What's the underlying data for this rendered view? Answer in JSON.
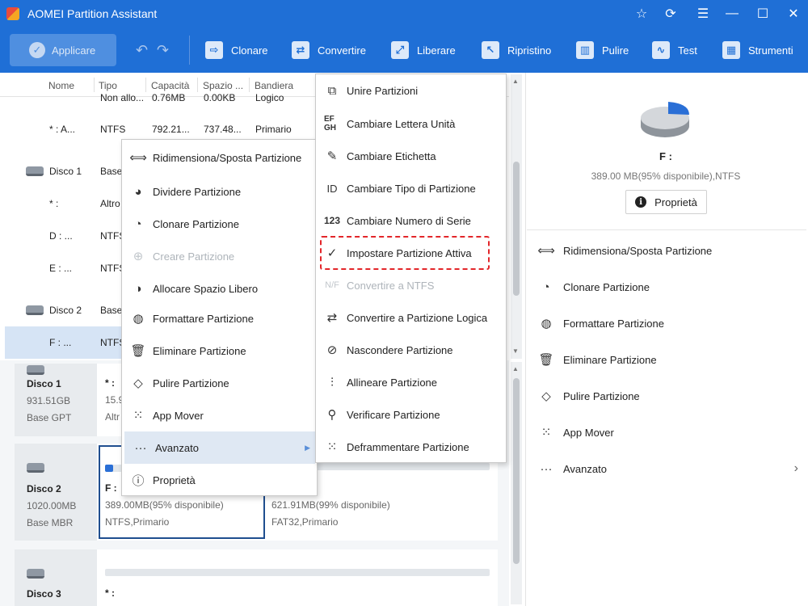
{
  "titlebar": {
    "title": "AOMEI Partition Assistant"
  },
  "window_controls": [
    "star-icon",
    "refresh-icon",
    "menu-icon",
    "minimize-icon",
    "maximize-icon",
    "close-icon"
  ],
  "toolbar": {
    "apply_label": "Applicare",
    "items": [
      {
        "label": "Clonare",
        "icon": "clone-icon"
      },
      {
        "label": "Convertire",
        "icon": "convert-icon"
      },
      {
        "label": "Liberare",
        "icon": "free-up-icon"
      },
      {
        "label": "Ripristino",
        "icon": "recovery-icon"
      },
      {
        "label": "Pulire",
        "icon": "wipe-icon"
      },
      {
        "label": "Test",
        "icon": "test-icon"
      },
      {
        "label": "Strumenti",
        "icon": "tools-icon"
      }
    ]
  },
  "columns": [
    "Nome",
    "Tipo",
    "Capacità",
    "Spazio ...",
    "Bandiera"
  ],
  "rows": [
    {
      "name": "",
      "type": "Non allo...",
      "cap": "0.76MB",
      "used": "0.00KB",
      "flag": "Logico"
    },
    {
      "name": "* : A...",
      "type": "NTFS",
      "cap": "792.21...",
      "used": "737.48...",
      "flag": "Primario"
    },
    {
      "name": "Disco 1",
      "type": "Base",
      "disk": true
    },
    {
      "name": "* :",
      "type": "Altro"
    },
    {
      "name": "D : ...",
      "type": "NTFS"
    },
    {
      "name": "E : ...",
      "type": "NTFS"
    },
    {
      "name": "Disco 2",
      "type": "Base",
      "disk": true
    },
    {
      "name": "F : ...",
      "type": "NTFS",
      "selected": true
    }
  ],
  "disks": [
    {
      "name": "Disco 1",
      "size": "931.51GB",
      "type": "Base GPT",
      "p1_name": "* :",
      "p1_size": "15.9",
      "p1_fs": "Altr"
    },
    {
      "name": "Disco 2",
      "size": "1020.00MB",
      "type": "Base MBR",
      "p1_name": "F :",
      "p1_size": "389.00MB(95% disponibile)",
      "p1_fs": "NTFS,Primario",
      "p2_size": "621.91MB(99% disponibile)",
      "p2_fs": "FAT32,Primario"
    },
    {
      "name": "Disco 3",
      "p1_name": "* :"
    }
  ],
  "context_menu": [
    {
      "label": "Ridimensiona/Sposta Partizione",
      "icon": "resize-icon"
    },
    {
      "label": "Dividere Partizione",
      "icon": "split-icon"
    },
    {
      "label": "Clonare Partizione",
      "icon": "clone-partition-icon"
    },
    {
      "label": "Creare Partizione",
      "icon": "create-partition-icon",
      "disabled": true
    },
    {
      "label": "Allocare Spazio Libero",
      "icon": "allocate-icon"
    },
    {
      "label": "Formattare Partizione",
      "icon": "format-icon"
    },
    {
      "label": "Eliminare Partizione",
      "icon": "trash-icon"
    },
    {
      "label": "Pulire Partizione",
      "icon": "eraser-icon"
    },
    {
      "label": "App Mover",
      "icon": "app-mover-icon"
    },
    {
      "label": "Avanzato",
      "icon": "more-icon",
      "hover": true,
      "submenu": true
    },
    {
      "label": "Proprietà",
      "icon": "info-icon"
    }
  ],
  "submenu": [
    {
      "label": "Unire Partizioni",
      "icon": "merge-icon"
    },
    {
      "label": "Cambiare Lettera Unità",
      "icon": "drive-letter-icon"
    },
    {
      "label": "Cambiare Etichetta",
      "icon": "pencil-icon"
    },
    {
      "label": "Cambiare Tipo di Partizione",
      "icon": "id-icon"
    },
    {
      "label": "Cambiare Numero di Serie",
      "icon": "serial-number-icon"
    },
    {
      "label": "Impostare Partizione Attiva",
      "icon": "set-active-icon",
      "highlighted": true
    },
    {
      "label": "Convertire a NTFS",
      "icon": "convert-ntfs-icon",
      "disabled": true
    },
    {
      "label": "Convertire a Partizione Logica",
      "icon": "convert-logical-icon"
    },
    {
      "label": "Nascondere Partizione",
      "icon": "hide-icon"
    },
    {
      "label": "Allineare Partizione",
      "icon": "align-icon"
    },
    {
      "label": "Verificare Partizione",
      "icon": "search-icon"
    },
    {
      "label": "Deframmentare Partizione",
      "icon": "defrag-icon"
    }
  ],
  "right_panel": {
    "drive": "F :",
    "info": "389.00 MB(95% disponibile),NTFS",
    "properties_label": "Proprietà",
    "used_fraction": 0.05,
    "ops": [
      {
        "label": "Ridimensiona/Sposta Partizione",
        "icon": "resize-icon"
      },
      {
        "label": "Clonare Partizione",
        "icon": "clone-partition-icon"
      },
      {
        "label": "Formattare Partizione",
        "icon": "format-icon"
      },
      {
        "label": "Eliminare Partizione",
        "icon": "trash-icon"
      },
      {
        "label": "Pulire Partizione",
        "icon": "eraser-icon"
      },
      {
        "label": "App Mover",
        "icon": "app-mover-icon"
      },
      {
        "label": "Avanzato",
        "icon": "more-icon",
        "submenu": true
      }
    ]
  },
  "colors": {
    "brand": "#1f6fd6",
    "selection": "#d6e4f5",
    "highlight_border": "#e3262a"
  }
}
